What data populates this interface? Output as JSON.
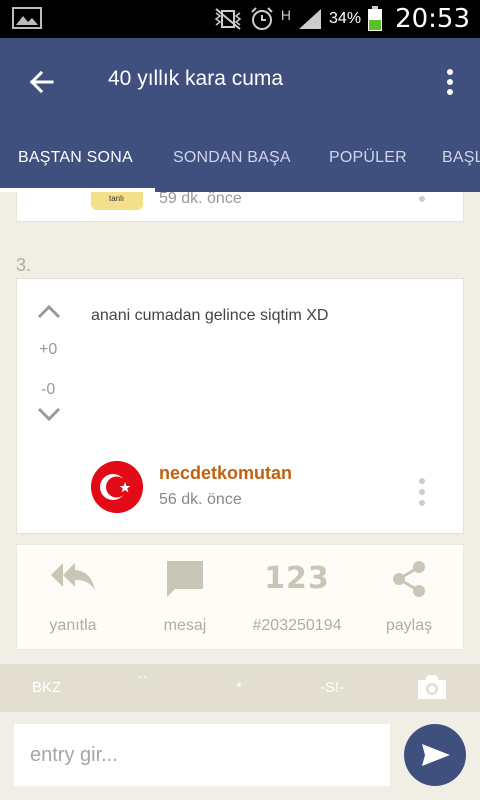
{
  "status_bar": {
    "battery_percent": "34%",
    "time": "20:53",
    "network": "H"
  },
  "app_bar": {
    "title": "40 yıllık kara cuma"
  },
  "tabs": [
    {
      "label": "BAŞTAN SONA",
      "active": true
    },
    {
      "label": "SONDAN BAŞA",
      "active": false
    },
    {
      "label": "POPÜLER",
      "active": false
    },
    {
      "label": "BAŞL",
      "active": false
    }
  ],
  "previous_entry": {
    "avatar_text": "tanlı",
    "time": "59 dk. önce"
  },
  "entry": {
    "number": "3.",
    "text": "anani cumadan gelince siqtim XD",
    "upvotes": "+0",
    "downvotes": "-0",
    "author": "necdetkomutan",
    "time": "56 dk. önce"
  },
  "actions": [
    {
      "label": "yanıtla",
      "icon": "reply-all-icon"
    },
    {
      "label": "mesaj",
      "icon": "message-icon"
    },
    {
      "label": "#203250194",
      "icon": "number-123-icon",
      "icon_text": "123"
    },
    {
      "label": "paylaş",
      "icon": "share-icon"
    }
  ],
  "markup_bar": {
    "bkz": "BKZ",
    "backtick": "``",
    "star": "*",
    "spoiler": "-S!-"
  },
  "input": {
    "placeholder": "entry gir..."
  },
  "colors": {
    "primary": "#3f4f7e",
    "author": "#c0620f",
    "background": "#f1efe5"
  }
}
